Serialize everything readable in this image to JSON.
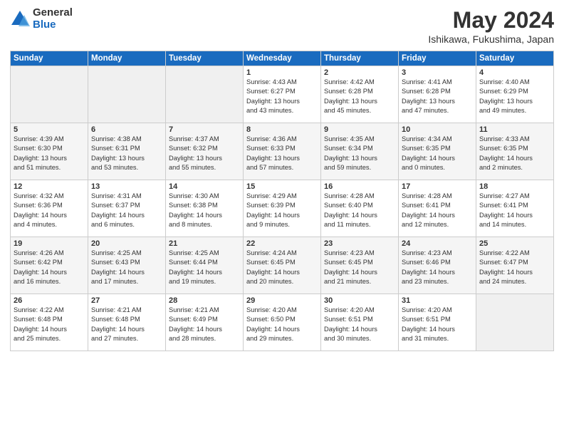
{
  "logo": {
    "general": "General",
    "blue": "Blue"
  },
  "title": "May 2024",
  "subtitle": "Ishikawa, Fukushima, Japan",
  "headers": [
    "Sunday",
    "Monday",
    "Tuesday",
    "Wednesday",
    "Thursday",
    "Friday",
    "Saturday"
  ],
  "weeks": [
    [
      {
        "day": "",
        "info": ""
      },
      {
        "day": "",
        "info": ""
      },
      {
        "day": "",
        "info": ""
      },
      {
        "day": "1",
        "info": "Sunrise: 4:43 AM\nSunset: 6:27 PM\nDaylight: 13 hours\nand 43 minutes."
      },
      {
        "day": "2",
        "info": "Sunrise: 4:42 AM\nSunset: 6:28 PM\nDaylight: 13 hours\nand 45 minutes."
      },
      {
        "day": "3",
        "info": "Sunrise: 4:41 AM\nSunset: 6:28 PM\nDaylight: 13 hours\nand 47 minutes."
      },
      {
        "day": "4",
        "info": "Sunrise: 4:40 AM\nSunset: 6:29 PM\nDaylight: 13 hours\nand 49 minutes."
      }
    ],
    [
      {
        "day": "5",
        "info": "Sunrise: 4:39 AM\nSunset: 6:30 PM\nDaylight: 13 hours\nand 51 minutes."
      },
      {
        "day": "6",
        "info": "Sunrise: 4:38 AM\nSunset: 6:31 PM\nDaylight: 13 hours\nand 53 minutes."
      },
      {
        "day": "7",
        "info": "Sunrise: 4:37 AM\nSunset: 6:32 PM\nDaylight: 13 hours\nand 55 minutes."
      },
      {
        "day": "8",
        "info": "Sunrise: 4:36 AM\nSunset: 6:33 PM\nDaylight: 13 hours\nand 57 minutes."
      },
      {
        "day": "9",
        "info": "Sunrise: 4:35 AM\nSunset: 6:34 PM\nDaylight: 13 hours\nand 59 minutes."
      },
      {
        "day": "10",
        "info": "Sunrise: 4:34 AM\nSunset: 6:35 PM\nDaylight: 14 hours\nand 0 minutes."
      },
      {
        "day": "11",
        "info": "Sunrise: 4:33 AM\nSunset: 6:35 PM\nDaylight: 14 hours\nand 2 minutes."
      }
    ],
    [
      {
        "day": "12",
        "info": "Sunrise: 4:32 AM\nSunset: 6:36 PM\nDaylight: 14 hours\nand 4 minutes."
      },
      {
        "day": "13",
        "info": "Sunrise: 4:31 AM\nSunset: 6:37 PM\nDaylight: 14 hours\nand 6 minutes."
      },
      {
        "day": "14",
        "info": "Sunrise: 4:30 AM\nSunset: 6:38 PM\nDaylight: 14 hours\nand 8 minutes."
      },
      {
        "day": "15",
        "info": "Sunrise: 4:29 AM\nSunset: 6:39 PM\nDaylight: 14 hours\nand 9 minutes."
      },
      {
        "day": "16",
        "info": "Sunrise: 4:28 AM\nSunset: 6:40 PM\nDaylight: 14 hours\nand 11 minutes."
      },
      {
        "day": "17",
        "info": "Sunrise: 4:28 AM\nSunset: 6:41 PM\nDaylight: 14 hours\nand 12 minutes."
      },
      {
        "day": "18",
        "info": "Sunrise: 4:27 AM\nSunset: 6:41 PM\nDaylight: 14 hours\nand 14 minutes."
      }
    ],
    [
      {
        "day": "19",
        "info": "Sunrise: 4:26 AM\nSunset: 6:42 PM\nDaylight: 14 hours\nand 16 minutes."
      },
      {
        "day": "20",
        "info": "Sunrise: 4:25 AM\nSunset: 6:43 PM\nDaylight: 14 hours\nand 17 minutes."
      },
      {
        "day": "21",
        "info": "Sunrise: 4:25 AM\nSunset: 6:44 PM\nDaylight: 14 hours\nand 19 minutes."
      },
      {
        "day": "22",
        "info": "Sunrise: 4:24 AM\nSunset: 6:45 PM\nDaylight: 14 hours\nand 20 minutes."
      },
      {
        "day": "23",
        "info": "Sunrise: 4:23 AM\nSunset: 6:45 PM\nDaylight: 14 hours\nand 21 minutes."
      },
      {
        "day": "24",
        "info": "Sunrise: 4:23 AM\nSunset: 6:46 PM\nDaylight: 14 hours\nand 23 minutes."
      },
      {
        "day": "25",
        "info": "Sunrise: 4:22 AM\nSunset: 6:47 PM\nDaylight: 14 hours\nand 24 minutes."
      }
    ],
    [
      {
        "day": "26",
        "info": "Sunrise: 4:22 AM\nSunset: 6:48 PM\nDaylight: 14 hours\nand 25 minutes."
      },
      {
        "day": "27",
        "info": "Sunrise: 4:21 AM\nSunset: 6:48 PM\nDaylight: 14 hours\nand 27 minutes."
      },
      {
        "day": "28",
        "info": "Sunrise: 4:21 AM\nSunset: 6:49 PM\nDaylight: 14 hours\nand 28 minutes."
      },
      {
        "day": "29",
        "info": "Sunrise: 4:20 AM\nSunset: 6:50 PM\nDaylight: 14 hours\nand 29 minutes."
      },
      {
        "day": "30",
        "info": "Sunrise: 4:20 AM\nSunset: 6:51 PM\nDaylight: 14 hours\nand 30 minutes."
      },
      {
        "day": "31",
        "info": "Sunrise: 4:20 AM\nSunset: 6:51 PM\nDaylight: 14 hours\nand 31 minutes."
      },
      {
        "day": "",
        "info": ""
      }
    ]
  ]
}
